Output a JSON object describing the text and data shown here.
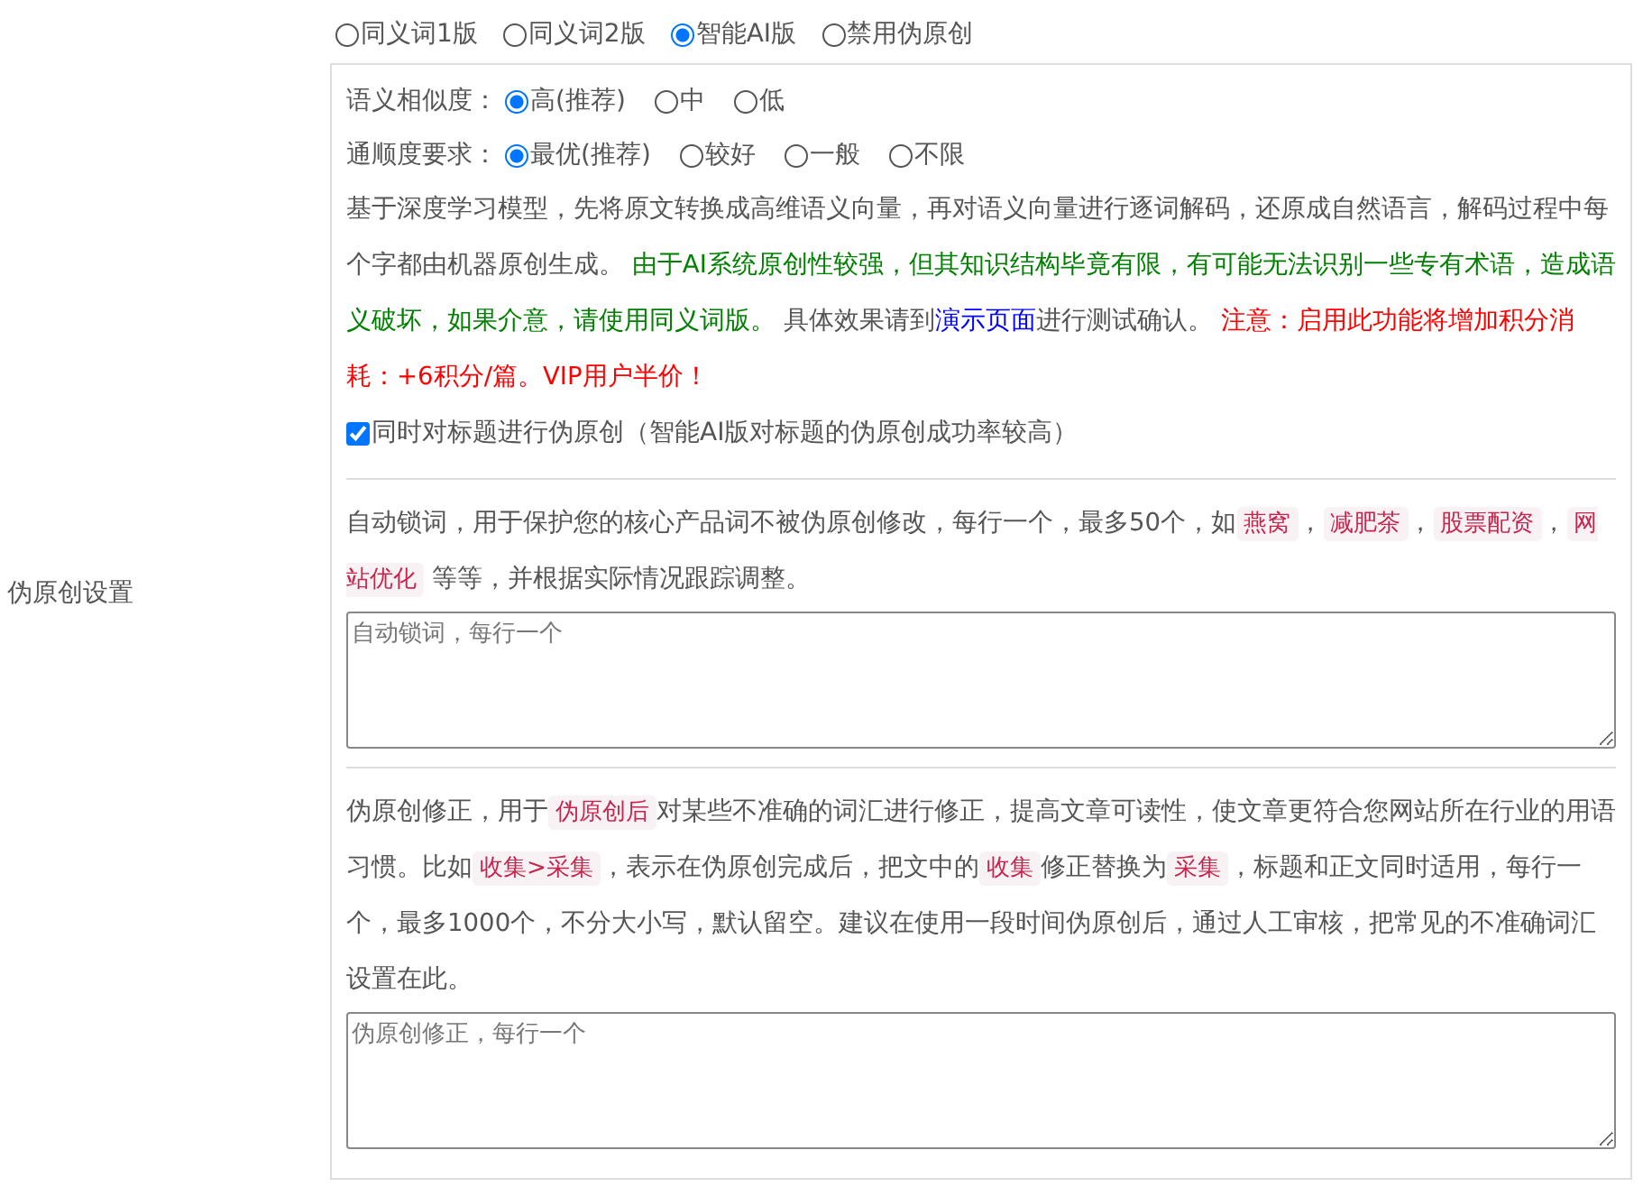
{
  "sidebar_label": "伪原创设置",
  "modes": [
    {
      "label": "同义词1版",
      "selected": false
    },
    {
      "label": "同义词2版",
      "selected": false
    },
    {
      "label": "智能AI版",
      "selected": true
    },
    {
      "label": "禁用伪原创",
      "selected": false
    }
  ],
  "ai_settings": {
    "similarity": {
      "label": "语义相似度：",
      "options": [
        {
          "label": "高(推荐)",
          "selected": true
        },
        {
          "label": "中",
          "selected": false
        },
        {
          "label": "低",
          "selected": false
        }
      ]
    },
    "fluency": {
      "label": "通顺度要求：",
      "options": [
        {
          "label": "最优(推荐)",
          "selected": true
        },
        {
          "label": "较好",
          "selected": false
        },
        {
          "label": "一般",
          "selected": false
        },
        {
          "label": "不限",
          "selected": false
        }
      ]
    },
    "description": [
      {
        "kind": "plain",
        "text": "基于深度学习模型，先将原文转换成高维语义向量，再对语义向量进行逐词解码，还原成自然语言，解码过程中每个字都由机器原创生成。 "
      },
      {
        "kind": "green",
        "text": "由于AI系统原创性较强，但其知识结构毕竟有限，有可能无法识别一些专有术语，造成语义破坏，如果介意，请使用同义词版。"
      },
      {
        "kind": "plain",
        "text": " 具体效果请到"
      },
      {
        "kind": "link",
        "text": "演示页面"
      },
      {
        "kind": "plain",
        "text": "进行测试确认。 "
      },
      {
        "kind": "red",
        "text": "注意：启用此功能将增加积分消耗：+6积分/篇。VIP用户半价！"
      }
    ],
    "title_checkbox": {
      "label": "同时对标题进行伪原创（智能AI版对标题的伪原创成功率较高）",
      "checked": true
    }
  },
  "lock_words": {
    "description": [
      {
        "kind": "plain",
        "text": "自动锁词，用于保护您的核心产品词不被伪原创修改，每行一个，最多50个，如"
      },
      {
        "kind": "tag",
        "text": "燕窝"
      },
      {
        "kind": "plain",
        "text": "，"
      },
      {
        "kind": "tag",
        "text": "减肥茶"
      },
      {
        "kind": "plain",
        "text": "，"
      },
      {
        "kind": "tag",
        "text": "股票配资"
      },
      {
        "kind": "plain",
        "text": "，"
      },
      {
        "kind": "tag",
        "text": "网站优化"
      },
      {
        "kind": "plain",
        "text": " 等等，并根据实际情况跟踪调整。"
      }
    ],
    "placeholder": "自动锁词，每行一个"
  },
  "corrections": {
    "description": [
      {
        "kind": "plain",
        "text": "伪原创修正，用于"
      },
      {
        "kind": "tag",
        "text": "伪原创后"
      },
      {
        "kind": "plain",
        "text": "对某些不准确的词汇进行修正，提高文章可读性，使文章更符合您网站所在行业的用语习惯。比如"
      },
      {
        "kind": "tag",
        "text": "收集>采集"
      },
      {
        "kind": "plain",
        "text": "，表示在伪原创完成后，把文中的"
      },
      {
        "kind": "tag",
        "text": "收集"
      },
      {
        "kind": "plain",
        "text": "修正替换为"
      },
      {
        "kind": "tag",
        "text": "采集"
      },
      {
        "kind": "plain",
        "text": "，标题和正文同时适用，每行一个，最多1000个，不分大小写，默认留空。建议在使用一段时间伪原创后，通过人工审核，把常见的不准确词汇设置在此。"
      }
    ],
    "placeholder": "伪原创修正，每行一个"
  }
}
